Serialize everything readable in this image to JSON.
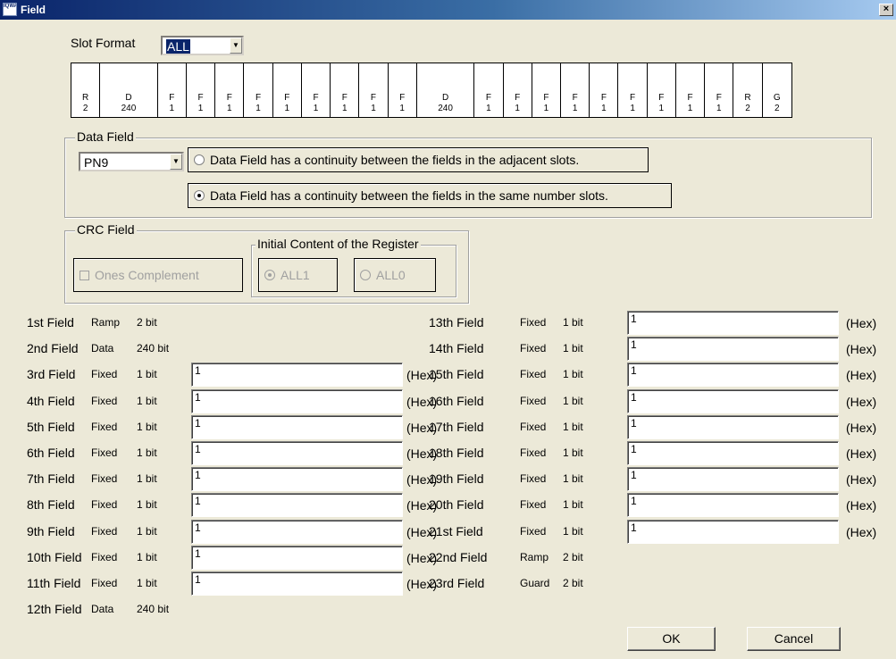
{
  "window": {
    "title": "Field",
    "icon_text": "IQWA",
    "close_glyph": "×"
  },
  "slot_format": {
    "label": "Slot Format",
    "value": "ALL",
    "arrow": "▼"
  },
  "slots": [
    {
      "t": "R",
      "n": "2"
    },
    {
      "t": "D",
      "n": "240"
    },
    {
      "t": "F",
      "n": "1"
    },
    {
      "t": "F",
      "n": "1"
    },
    {
      "t": "F",
      "n": "1"
    },
    {
      "t": "F",
      "n": "1"
    },
    {
      "t": "F",
      "n": "1"
    },
    {
      "t": "F",
      "n": "1"
    },
    {
      "t": "F",
      "n": "1"
    },
    {
      "t": "F",
      "n": "1"
    },
    {
      "t": "F",
      "n": "1"
    },
    {
      "t": "D",
      "n": "240"
    },
    {
      "t": "F",
      "n": "1"
    },
    {
      "t": "F",
      "n": "1"
    },
    {
      "t": "F",
      "n": "1"
    },
    {
      "t": "F",
      "n": "1"
    },
    {
      "t": "F",
      "n": "1"
    },
    {
      "t": "F",
      "n": "1"
    },
    {
      "t": "F",
      "n": "1"
    },
    {
      "t": "F",
      "n": "1"
    },
    {
      "t": "F",
      "n": "1"
    },
    {
      "t": "R",
      "n": "2"
    },
    {
      "t": "G",
      "n": "2"
    }
  ],
  "data_field": {
    "title": "Data Field",
    "pattern": "PN9",
    "arrow": "▼",
    "option_adjacent": "Data Field has a continuity between the fields in the adjacent slots.",
    "option_same": "Data Field has a continuity between the fields in the same number slots.",
    "selected": "same"
  },
  "crc_field": {
    "title": "CRC Field",
    "ones_complement": "Ones Complement",
    "initial_title": "Initial Content of the Register",
    "all1": "ALL1",
    "all0": "ALL0"
  },
  "fields_left": [
    {
      "name": "1st Field",
      "type": "Ramp",
      "bits": "2 bit"
    },
    {
      "name": "2nd Field",
      "type": "Data",
      "bits": "240 bit"
    },
    {
      "name": "3rd Field",
      "type": "Fixed",
      "bits": "1 bit",
      "value": "1",
      "unit": "(Hex)"
    },
    {
      "name": "4th Field",
      "type": "Fixed",
      "bits": "1 bit",
      "value": "1",
      "unit": "(Hex)"
    },
    {
      "name": "5th Field",
      "type": "Fixed",
      "bits": "1 bit",
      "value": "1",
      "unit": "(Hex)"
    },
    {
      "name": "6th Field",
      "type": "Fixed",
      "bits": "1 bit",
      "value": "1",
      "unit": "(Hex)"
    },
    {
      "name": "7th Field",
      "type": "Fixed",
      "bits": "1 bit",
      "value": "1",
      "unit": "(Hex)"
    },
    {
      "name": "8th Field",
      "type": "Fixed",
      "bits": "1 bit",
      "value": "1",
      "unit": "(Hex)"
    },
    {
      "name": "9th Field",
      "type": "Fixed",
      "bits": "1 bit",
      "value": "1",
      "unit": "(Hex)"
    },
    {
      "name": "10th Field",
      "type": "Fixed",
      "bits": "1 bit",
      "value": "1",
      "unit": "(Hex)"
    },
    {
      "name": "11th Field",
      "type": "Fixed",
      "bits": "1 bit",
      "value": "1",
      "unit": "(Hex)"
    },
    {
      "name": "12th Field",
      "type": "Data",
      "bits": "240 bit"
    }
  ],
  "fields_right": [
    {
      "name": "13th Field",
      "type": "Fixed",
      "bits": "1 bit",
      "value": "1",
      "unit": "(Hex)"
    },
    {
      "name": "14th Field",
      "type": "Fixed",
      "bits": "1 bit",
      "value": "1",
      "unit": "(Hex)"
    },
    {
      "name": "15th Field",
      "type": "Fixed",
      "bits": "1 bit",
      "value": "1",
      "unit": "(Hex)"
    },
    {
      "name": "16th Field",
      "type": "Fixed",
      "bits": "1 bit",
      "value": "1",
      "unit": "(Hex)"
    },
    {
      "name": "17th Field",
      "type": "Fixed",
      "bits": "1 bit",
      "value": "1",
      "unit": "(Hex)"
    },
    {
      "name": "18th Field",
      "type": "Fixed",
      "bits": "1 bit",
      "value": "1",
      "unit": "(Hex)"
    },
    {
      "name": "19th Field",
      "type": "Fixed",
      "bits": "1 bit",
      "value": "1",
      "unit": "(Hex)"
    },
    {
      "name": "20th Field",
      "type": "Fixed",
      "bits": "1 bit",
      "value": "1",
      "unit": "(Hex)"
    },
    {
      "name": "21st Field",
      "type": "Fixed",
      "bits": "1 bit",
      "value": "1",
      "unit": "(Hex)"
    },
    {
      "name": "22nd Field",
      "type": "Ramp",
      "bits": "2 bit"
    },
    {
      "name": "23rd Field",
      "type": "Guard",
      "bits": "2 bit"
    }
  ],
  "buttons": {
    "ok": "OK",
    "cancel": "Cancel"
  }
}
